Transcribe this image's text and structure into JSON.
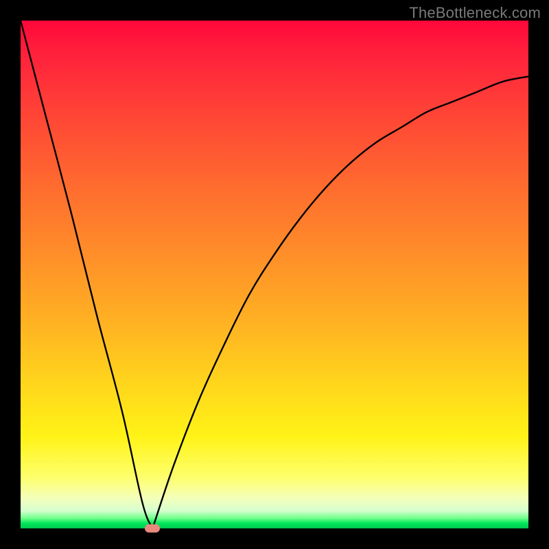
{
  "watermark": "TheBottleneck.com",
  "colors": {
    "frame": "#000000",
    "gradient_top": "#ff073a",
    "gradient_mid": "#ffd71c",
    "gradient_bottom": "#00c84f",
    "curve": "#000000",
    "marker": "#e9887f"
  },
  "chart_data": {
    "type": "line",
    "title": "",
    "xlabel": "",
    "ylabel": "",
    "xlim": [
      0,
      100
    ],
    "ylim": [
      0,
      100
    ],
    "grid": false,
    "legend": false,
    "annotations": [
      "TheBottleneck.com"
    ],
    "series": [
      {
        "name": "left-branch",
        "x": [
          0,
          5,
          10,
          15,
          20,
          24,
          26
        ],
        "values": [
          100,
          81,
          62,
          42,
          23,
          5,
          0
        ]
      },
      {
        "name": "right-branch",
        "x": [
          26,
          30,
          35,
          40,
          45,
          50,
          55,
          60,
          65,
          70,
          75,
          80,
          85,
          90,
          95,
          100
        ],
        "values": [
          0,
          12,
          25,
          36,
          46,
          54,
          61,
          67,
          72,
          76,
          79,
          82,
          84,
          86,
          88,
          89
        ]
      }
    ],
    "marker": {
      "x": 26,
      "y": 0
    },
    "gradient_stops": [
      {
        "pct": 0,
        "color": "#ff073a"
      },
      {
        "pct": 32,
        "color": "#ff6a2f"
      },
      {
        "pct": 72,
        "color": "#ffd71c"
      },
      {
        "pct": 94,
        "color": "#f4ffb9"
      },
      {
        "pct": 100,
        "color": "#00c84f"
      }
    ]
  }
}
